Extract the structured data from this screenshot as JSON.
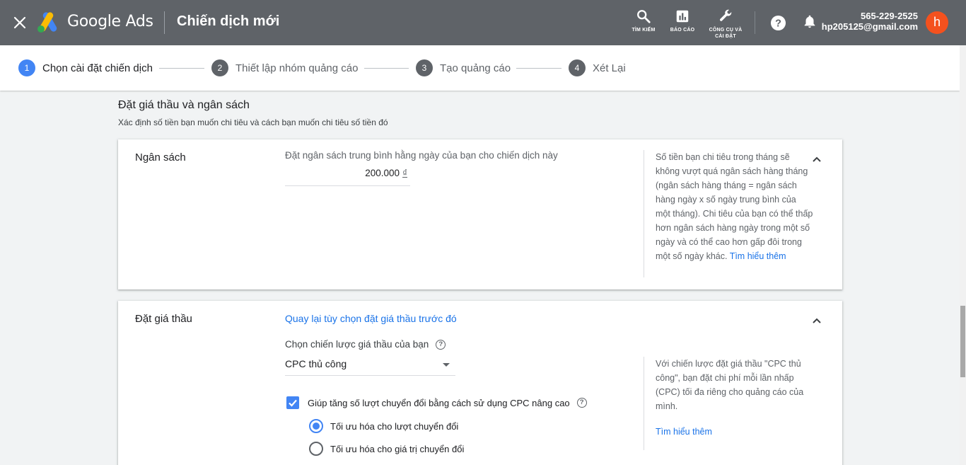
{
  "header": {
    "brand": "Google Ads",
    "page_title": "Chiến dịch mới",
    "tools": [
      {
        "icon": "search-icon",
        "label": "TÌM KIẾM"
      },
      {
        "icon": "report-icon",
        "label": "BÁO CÁO"
      },
      {
        "icon": "wrench-icon",
        "label_line1": "CÔNG CỤ VÀ",
        "label_line2": "CÀI ĐẶT"
      }
    ],
    "account": {
      "id": "565-229-2525",
      "email": "hp205125@gmail.com",
      "avatar_letter": "h"
    }
  },
  "stepper": {
    "steps": [
      {
        "num": "1",
        "label": "Chọn cài đặt chiến dịch",
        "active": true
      },
      {
        "num": "2",
        "label": "Thiết lập nhóm quảng cáo"
      },
      {
        "num": "3",
        "label": "Tạo quảng cáo"
      },
      {
        "num": "4",
        "label": "Xét Lại"
      }
    ]
  },
  "section": {
    "title": "Đặt giá thầu và ngân sách",
    "subtitle": "Xác định số tiền bạn muốn chi tiêu và cách bạn muốn chi tiêu số tiền đó"
  },
  "budget_card": {
    "label": "Ngân sách",
    "hint": "Đặt ngân sách trung bình hằng ngày của bạn cho chiến dịch này",
    "value": "200.000",
    "currency": "₫",
    "help_text": "Số tiền bạn chi tiêu trong tháng sẽ không vượt quá ngân sách hàng tháng (ngân sách hàng tháng = ngân sách hàng ngày x số ngày trung bình của một tháng). Chi tiêu của bạn có thể thấp hơn ngân sách hàng ngày trong một số ngày và có thể cao hơn gấp đôi trong một số ngày khác.",
    "help_link": "Tìm hiểu thêm"
  },
  "bidding_card": {
    "label": "Đặt giá thầu",
    "back_link": "Quay lại tùy chọn đặt giá thầu trước đó",
    "strategy_label": "Chọn chiến lược giá thầu của bạn",
    "strategy_value": "CPC thủ công",
    "checkbox_label": "Giúp tăng số lượt chuyển đổi bằng cách sử dụng CPC nâng cao",
    "checkbox_checked": true,
    "radio_options": [
      {
        "label": "Tối ưu hóa cho lượt chuyển đổi",
        "selected": true
      },
      {
        "label": "Tối ưu hóa cho giá trị chuyển đổi",
        "selected": false
      }
    ],
    "help_text": "Với chiến lược đặt giá thầu \"CPC thủ công\", bạn đặt chi phí mỗi lần nhấp (CPC) tối đa riêng cho quảng cáo của mình.",
    "help_link": "Tìm hiểu thêm"
  },
  "colors": {
    "topbar": "#5f6368",
    "accent": "#4285f4",
    "link": "#1a73e8",
    "avatar": "#f4511e"
  }
}
